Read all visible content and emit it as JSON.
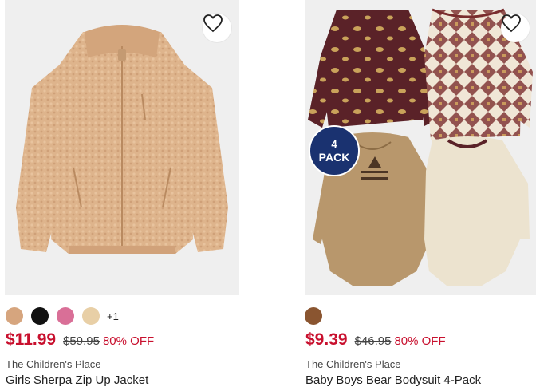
{
  "products": [
    {
      "image_alt": "Tan sherpa fleece zip-up jacket",
      "swatches": [
        "#d6a57e",
        "#111111",
        "#d96f97",
        "#e8cfa6"
      ],
      "more_colors": "+1",
      "sale_price": "$11.99",
      "original_price": "$59.95",
      "discount": "80% OFF",
      "brand": "The Children's Place",
      "title": "Girls Sherpa Zip Up Jacket"
    },
    {
      "image_alt": "Four baby bodysuits with bear prints",
      "badge_number": "4",
      "badge_label": "PACK",
      "swatches": [
        "#8a5530"
      ],
      "sale_price": "$9.39",
      "original_price": "$46.95",
      "discount": "80% OFF",
      "brand": "The Children's Place",
      "title": "Baby Boys Bear Bodysuit 4-Pack"
    }
  ],
  "icons": {
    "wishlist": "heart-outline-icon"
  },
  "colors": {
    "sale": "#c8102e",
    "badge": "#1a3270",
    "image_bg": "#efefef"
  }
}
